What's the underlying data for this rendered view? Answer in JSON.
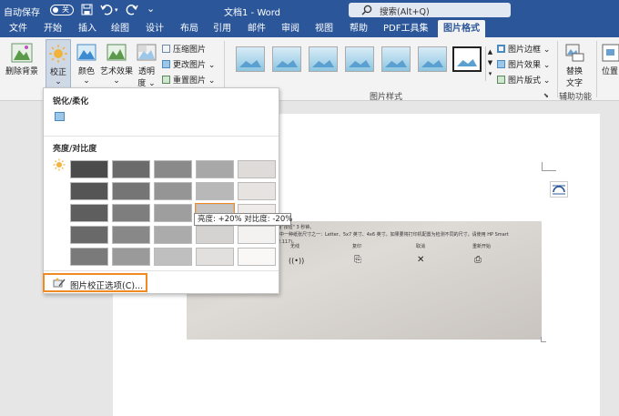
{
  "titlebar": {
    "autosave_label": "自动保存",
    "autosave_state": "关",
    "doc_title": "文档1 - Word",
    "search_placeholder": "搜索(Alt+Q)",
    "icons": [
      "save-icon",
      "undo-icon",
      "redo-icon",
      "search-icon"
    ]
  },
  "tabs": [
    "文件",
    "开始",
    "插入",
    "绘图",
    "设计",
    "布局",
    "引用",
    "邮件",
    "审阅",
    "视图",
    "帮助",
    "PDF工具集",
    "图片格式"
  ],
  "active_tab": "图片格式",
  "ribbon": {
    "remove_bg": "删除背景",
    "corrections": "校正",
    "color": "颜色",
    "art_effects": "艺术效果",
    "transparency": "透明",
    "transparency2": "度",
    "compress": "压缩图片",
    "change": "更改图片",
    "reset": "重置图片",
    "style_group": "图片样式",
    "border": "图片边框",
    "effects": "图片效果",
    "layout": "图片版式",
    "alt_text": "替换",
    "alt_text2": "文字",
    "accessibility": "辅助功能",
    "position": "位置"
  },
  "dropdown": {
    "sharpen_header": "锐化/柔化",
    "brightness_header": "亮度/对比度",
    "option_label": "图片校正选项(C)...",
    "tooltip": "亮度: +20% 对比度: -20%",
    "grid": [
      [
        "#4b4b4b",
        "#6b6b6b",
        "#8a8a8a",
        "#a8a8a8",
        "#dedbd8"
      ],
      [
        "#555555",
        "#757575",
        "#959595",
        "#b8b8b8",
        "#e6e3e0"
      ],
      [
        "#5e5e5e",
        "#7e7e7e",
        "#9e9e9e",
        "#c6c4c2",
        "#eeebe8"
      ],
      [
        "#696969",
        "#888888",
        "#ababab",
        "#d5d3d1",
        "#f4f2f0"
      ],
      [
        "#7a7a7a",
        "#9a9a9a",
        "#bfbfbf",
        "#e2e0de",
        "#faf8f6"
      ]
    ],
    "accent": "#f08a24"
  },
  "photo": {
    "line1": "\"取消\"按钮\" 3 秒钟。",
    "line2": "下其中一种纸张尺寸之一：Letter、5x7 英寸、4x6 英寸。如果要将打印机配置为检测不同的尺寸，请使用 HP Smart",
    "line3": "14.2.117)。",
    "captions": [
      "无线",
      "复印",
      "取消",
      "重新开始"
    ],
    "icon_glyphs": [
      "((•))",
      "⎘",
      "✕",
      "⎙"
    ]
  }
}
